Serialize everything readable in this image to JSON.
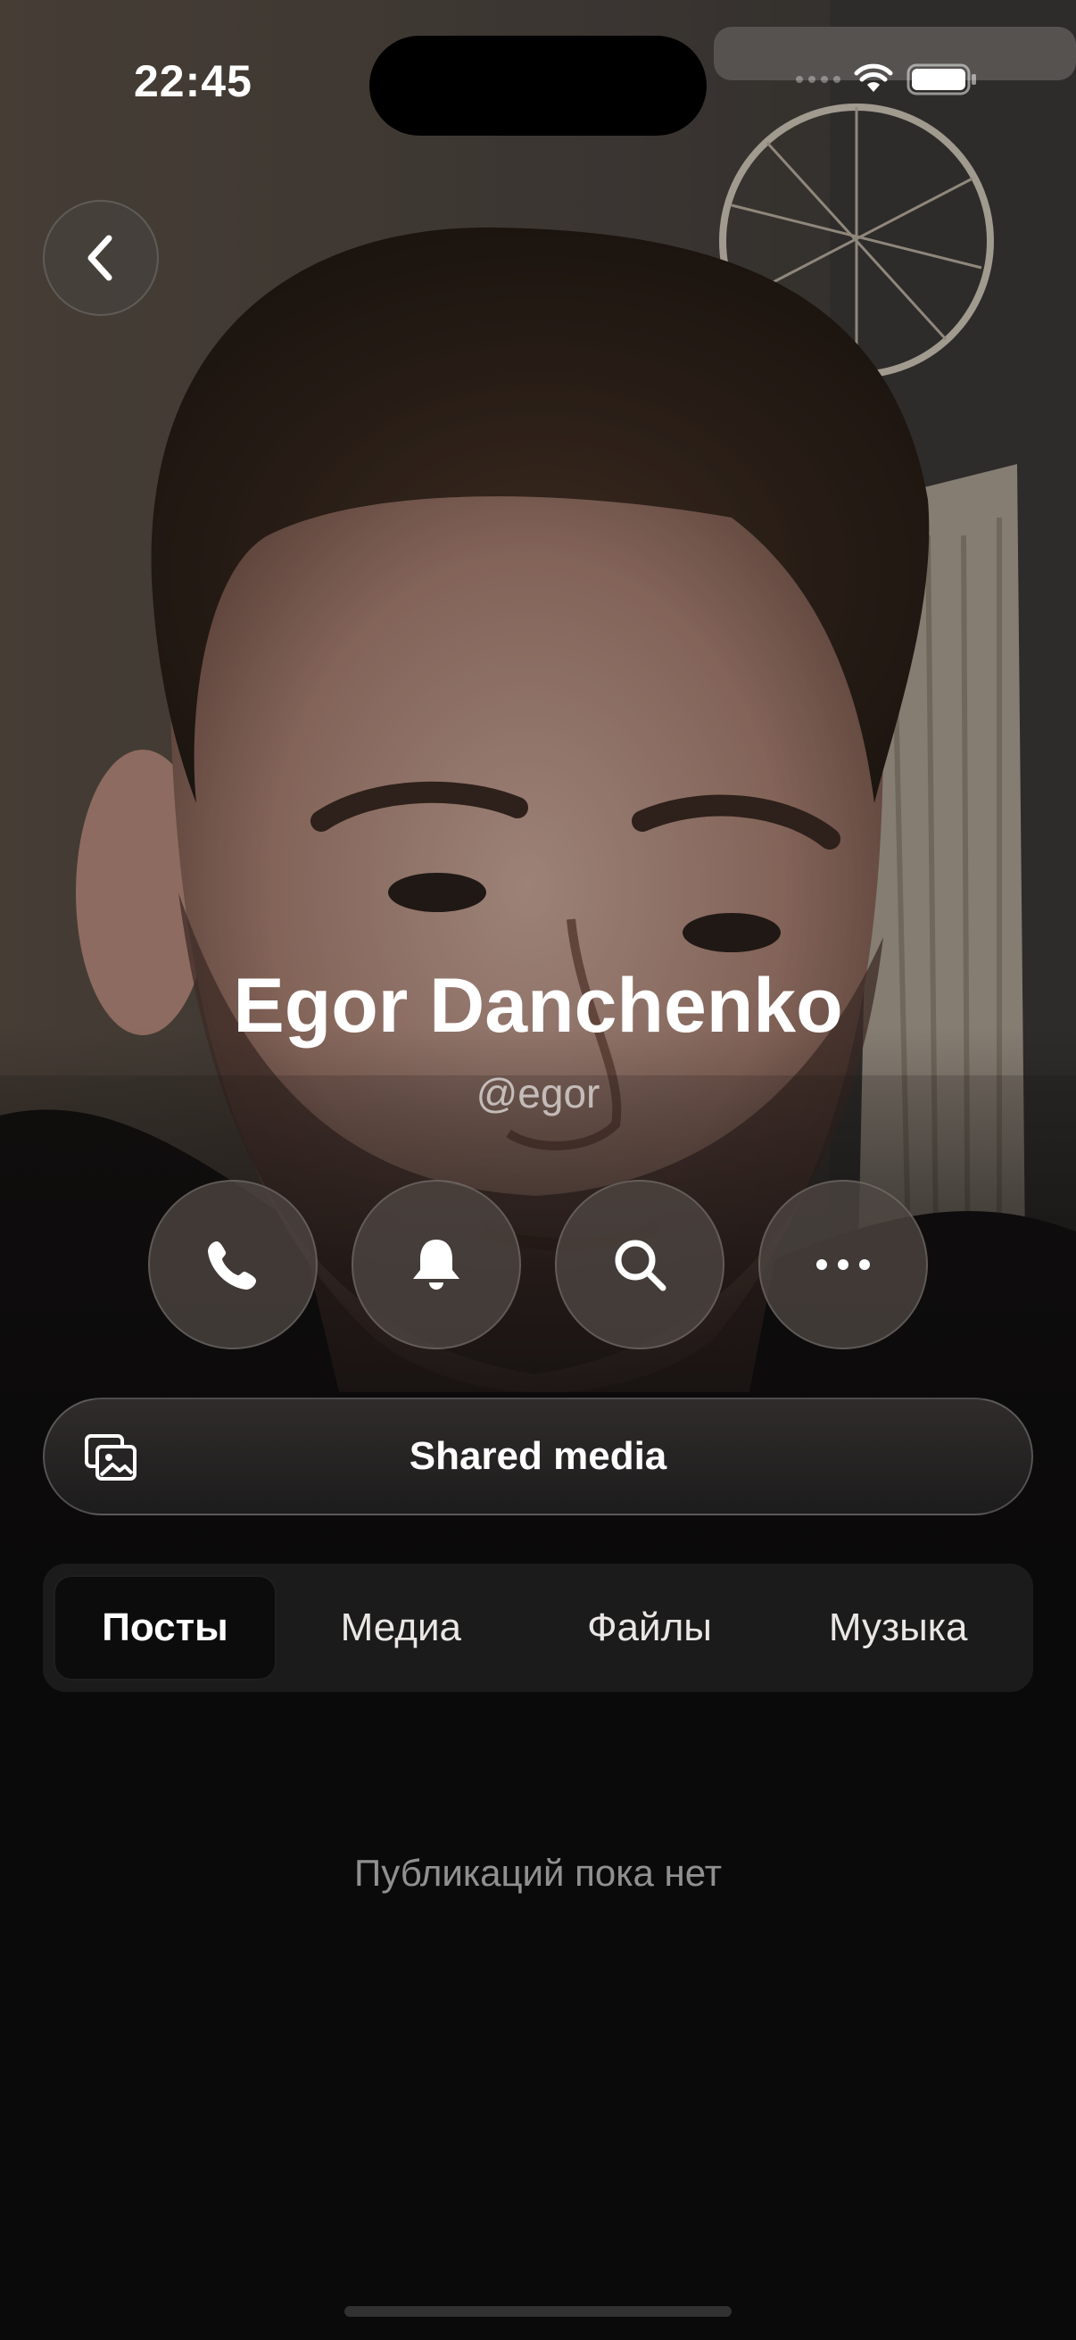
{
  "status_bar": {
    "time": "22:45"
  },
  "profile": {
    "name": "Egor Danchenko",
    "handle": "@egor"
  },
  "actions": [
    {
      "icon": "phone-icon"
    },
    {
      "icon": "bell-icon"
    },
    {
      "icon": "search-icon"
    },
    {
      "icon": "more-icon"
    }
  ],
  "shared_media": {
    "label": "Shared media",
    "icon": "gallery-icon"
  },
  "tabs": [
    {
      "label": "Посты",
      "active": true
    },
    {
      "label": "Медиа",
      "active": false
    },
    {
      "label": "Файлы",
      "active": false
    },
    {
      "label": "Музыка",
      "active": false
    }
  ],
  "empty_state": {
    "text": "Публикаций пока нет"
  },
  "colors": {
    "background": "#0b0a0a",
    "tab_bar": "#1c1b1b",
    "active_tab": "#0d0c0c"
  }
}
